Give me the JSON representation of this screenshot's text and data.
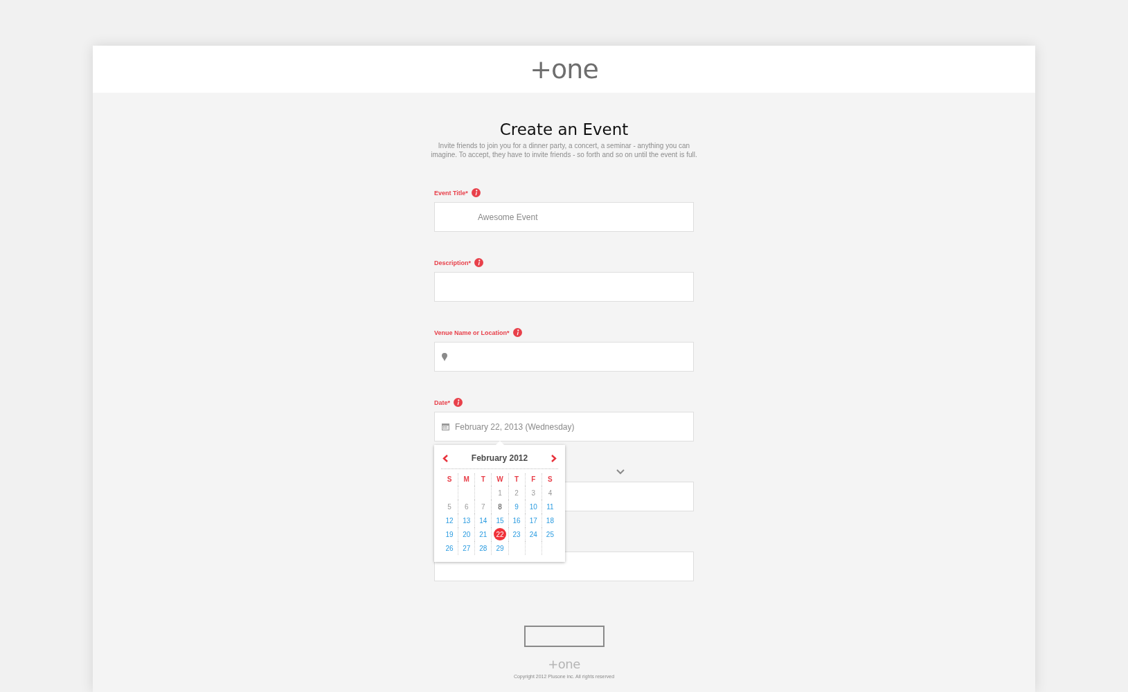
{
  "header": {
    "logo": "+one"
  },
  "intro": {
    "title": "Create an Event",
    "text": "Invite friends to join you for a dinner party, a concert, a seminar - anything you can imagine. To accept, they have to invite friends - so forth and so on until the event is full."
  },
  "fields": [
    {
      "kind": "text",
      "label": "Event Title*",
      "info": true,
      "value": "Awesome Event"
    },
    {
      "kind": "text",
      "label": "Description*",
      "info": true
    },
    {
      "kind": "location",
      "label": "Venue Name or Location*",
      "info": true
    },
    {
      "kind": "date",
      "label": "Date*",
      "info": true,
      "value": "February 22, 2013 (Wednesday)"
    },
    {
      "kind": "select"
    },
    {
      "kind": "text"
    }
  ],
  "calendar": {
    "month": "February 2012",
    "weekdays": [
      "S",
      "M",
      "T",
      "W",
      "T",
      "F",
      "S"
    ],
    "weeks": [
      {
        "starts_mid_week": true,
        "days": [
          {
            "day": "1",
            "kind": "past",
            "selected": false
          },
          {
            "day": "2",
            "kind": "past",
            "selected": false
          },
          {
            "day": "3",
            "kind": "past",
            "selected": false
          },
          {
            "day": "4",
            "kind": "past",
            "selected": false
          }
        ]
      },
      {
        "days": [
          {
            "day": "5",
            "kind": "past",
            "selected": false
          },
          {
            "day": "6",
            "kind": "past",
            "selected": false
          },
          {
            "day": "7",
            "kind": "past",
            "selected": false
          },
          {
            "day": "8",
            "kind": "today",
            "selected": false
          },
          {
            "day": "9",
            "kind": "open",
            "selected": false
          },
          {
            "day": "10",
            "kind": "open",
            "selected": false
          },
          {
            "day": "11",
            "kind": "open",
            "selected": false
          }
        ]
      },
      {
        "days": [
          {
            "day": "12",
            "kind": "open",
            "selected": false
          },
          {
            "day": "13",
            "kind": "open",
            "selected": false
          },
          {
            "day": "14",
            "kind": "open",
            "selected": false
          },
          {
            "day": "15",
            "kind": "open",
            "selected": false
          },
          {
            "day": "16",
            "kind": "open",
            "selected": false
          },
          {
            "day": "17",
            "kind": "open",
            "selected": false
          },
          {
            "day": "18",
            "kind": "open",
            "selected": false
          }
        ]
      },
      {
        "days": [
          {
            "day": "19",
            "kind": "open",
            "selected": false
          },
          {
            "day": "20",
            "kind": "open",
            "selected": false
          },
          {
            "day": "21",
            "kind": "open",
            "selected": false
          },
          {
            "day": "22",
            "kind": "open",
            "selected": true
          },
          {
            "day": "23",
            "kind": "open",
            "selected": false
          },
          {
            "day": "24",
            "kind": "open",
            "selected": false
          },
          {
            "day": "25",
            "kind": "open",
            "selected": false
          }
        ]
      },
      {
        "starts_mid_week": false,
        "days": [
          {
            "day": "26",
            "kind": "open",
            "selected": false
          },
          {
            "day": "27",
            "kind": "open",
            "selected": false
          },
          {
            "day": "28",
            "kind": "open",
            "selected": false
          },
          {
            "day": "29",
            "kind": "open",
            "selected": false
          }
        ]
      }
    ]
  },
  "footer": {
    "logo": "+one",
    "copyright": "Copyright 2012 Plusone inc. All rights reserved"
  }
}
